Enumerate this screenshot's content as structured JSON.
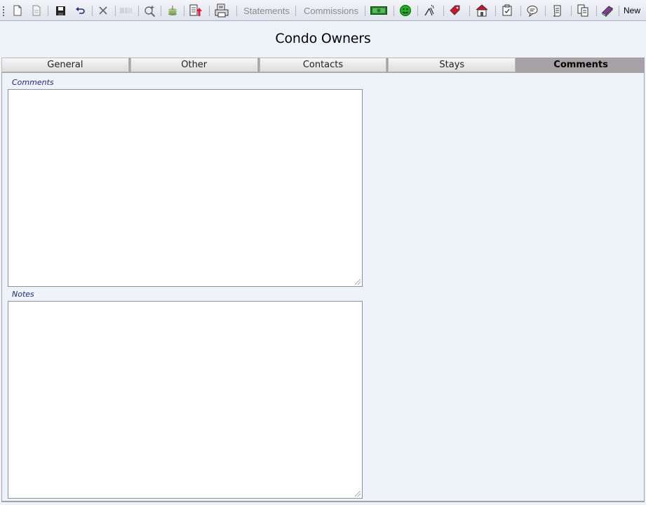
{
  "toolbar": {
    "items": [
      {
        "name": "new-document-icon"
      },
      {
        "name": "copy-document-icon"
      },
      {
        "name": "save-icon"
      },
      {
        "name": "undo-icon"
      },
      {
        "name": "delete-icon"
      },
      {
        "name": "barcode-icon"
      },
      {
        "name": "search-icon"
      },
      {
        "name": "money-icon"
      },
      {
        "name": "export-icon"
      },
      {
        "name": "print-icon"
      }
    ],
    "statements_label": "Statements",
    "commissions_label": "Commissions",
    "new_label": "New"
  },
  "page": {
    "title": "Condo Owners"
  },
  "tabs": [
    {
      "label": "General"
    },
    {
      "label": "Other"
    },
    {
      "label": "Contacts"
    },
    {
      "label": "Stays"
    },
    {
      "label": "Comments"
    }
  ],
  "active_tab": "Comments",
  "form": {
    "comments_label": "Comments",
    "comments_value": "",
    "notes_label": "Notes",
    "notes_value": ""
  },
  "colors": {
    "accent_text": "#1e2a7a",
    "active_tab": "#a7a0a4",
    "background": "#eef3fa"
  }
}
